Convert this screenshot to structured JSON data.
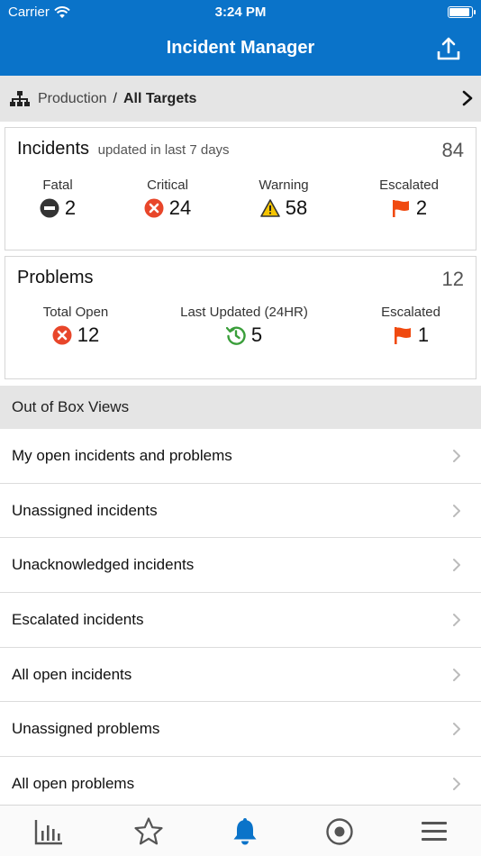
{
  "status_bar": {
    "carrier": "Carrier",
    "time": "3:24 PM"
  },
  "header": {
    "title": "Incident Manager",
    "share_icon": "share-upload-icon"
  },
  "breadcrumb": {
    "environment": "Production",
    "separator": "/",
    "target": "All Targets"
  },
  "incidents": {
    "title": "Incidents",
    "subtitle": "updated in last 7 days",
    "total": "84",
    "stats": [
      {
        "label": "Fatal",
        "value": "2",
        "icon": "fatal-minus-icon"
      },
      {
        "label": "Critical",
        "value": "24",
        "icon": "critical-x-icon"
      },
      {
        "label": "Warning",
        "value": "58",
        "icon": "warning-triangle-icon"
      },
      {
        "label": "Escalated",
        "value": "2",
        "icon": "flag-icon"
      }
    ]
  },
  "problems": {
    "title": "Problems",
    "total": "12",
    "stats": [
      {
        "label": "Total Open",
        "value": "12",
        "icon": "critical-x-icon"
      },
      {
        "label": "Last Updated (24HR)",
        "value": "5",
        "icon": "history-clock-icon"
      },
      {
        "label": "Escalated",
        "value": "1",
        "icon": "flag-icon"
      }
    ]
  },
  "views": {
    "header": "Out of Box Views",
    "items": [
      "My open incidents and problems",
      "Unassigned incidents",
      "Unacknowledged incidents",
      "Escalated incidents",
      "All open incidents",
      "Unassigned problems",
      "All open problems"
    ]
  },
  "tabbar": {
    "tabs": [
      "chart-icon",
      "star-icon",
      "bell-icon",
      "target-icon",
      "menu-icon"
    ],
    "active": "bell-icon"
  },
  "colors": {
    "header_bg": "#0a73c9",
    "critical": "#e8462a",
    "warning": "#f5c400",
    "escalated": "#f04a10",
    "history": "#3a9e3a",
    "active_tab": "#0a73c9"
  }
}
